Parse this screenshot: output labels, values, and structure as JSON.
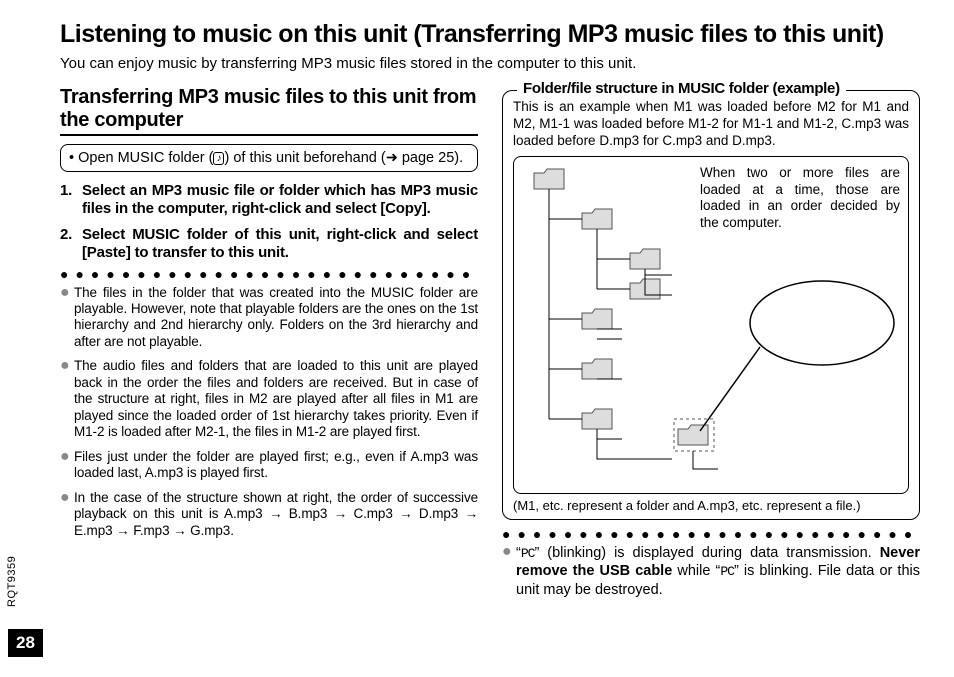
{
  "page": {
    "title": "Listening to music on this unit (Transferring MP3 music files to this unit)",
    "intro": "You can enjoy music by transferring MP3 music files stored in the computer to this unit.",
    "side_label": "RQT9359",
    "number": "28"
  },
  "left": {
    "heading": "Transferring MP3 music files to this unit from the computer",
    "open_folder_pre": "• Open MUSIC folder (",
    "open_folder_post": ") of this unit beforehand (➜ page 25).",
    "steps": [
      {
        "num": "1.",
        "text": "Select an MP3 music file or folder which has MP3 music files in the computer, right-click and select [Copy]."
      },
      {
        "num": "2.",
        "text": "Select MUSIC folder of this unit, right-click and select [Paste] to transfer to this unit."
      }
    ],
    "bullets": [
      "The files in the folder that was created into the MUSIC folder are playable. However, note that playable folders are the ones on the 1st hierarchy and 2nd hierarchy only. Folders on the 3rd hierarchy and after are not playable.",
      "The audio files and folders that are loaded to this unit are played back in the order the files and folders are received. But in case of the structure at right, files in M2 are played after all files in M1 are played since the loaded order of 1st hierarchy takes priority. Even if M1-2 is loaded after M2-1, the files in M1-2 are played first.",
      "Files just under the folder are played first; e.g., even if A.mp3 was loaded last, A.mp3 is played first.",
      "In the case of the structure shown at right, the order of successive playback on this unit is A.mp3 → B.mp3 → C.mp3 → D.mp3 → E.mp3 → F.mp3 → G.mp3."
    ]
  },
  "right": {
    "legend": "Folder/file structure in MUSIC folder (example)",
    "example_intro": "This is an example when M1 was loaded before M2 for M1 and M2, M1-1 was loaded before M1-2 for M1-1 and M1-2, C.mp3 was loaded before D.mp3 for C.mp3 and D.mp3.",
    "inner_note": "When two or more files are loaded at a time, those are loaded in an order decided by the computer.",
    "caption": "(M1, etc. represent a folder and A.mp3, etc. represent a file.)",
    "bullet_pre": "“",
    "bullet_mid1": "” (blinking) is displayed during data transmission. ",
    "bullet_bold": "Never remove the USB cable",
    "bullet_mid2": " while “",
    "bullet_post": "” is blinking. File data or this unit may be destroyed.",
    "pc_glyph": "PC"
  }
}
